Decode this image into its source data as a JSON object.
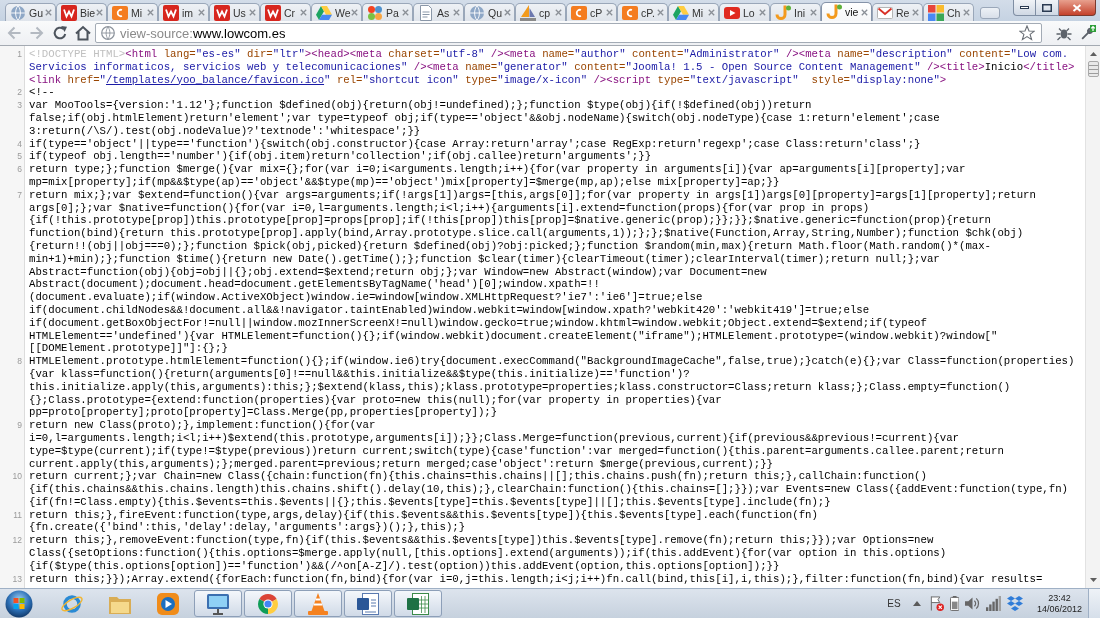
{
  "tabs": [
    {
      "title": "Gu",
      "kind": "globe",
      "selected": false
    },
    {
      "title": "Bie",
      "kind": "zigzag",
      "selected": false
    },
    {
      "title": "Mi",
      "kind": "arc",
      "selected": false
    },
    {
      "title": "im",
      "kind": "zigzag",
      "selected": false
    },
    {
      "title": "Us",
      "kind": "zigzag",
      "selected": false
    },
    {
      "title": "Cr",
      "kind": "zigzag",
      "selected": false
    },
    {
      "title": "We",
      "kind": "triangle",
      "selected": false
    },
    {
      "title": "Pa",
      "kind": "pinwheel",
      "selected": false
    },
    {
      "title": "As",
      "kind": "document",
      "selected": false
    },
    {
      "title": "Qu",
      "kind": "globe",
      "selected": false
    },
    {
      "title": "cp",
      "kind": "sail",
      "selected": false
    },
    {
      "title": "cP",
      "kind": "arc",
      "selected": false
    },
    {
      "title": "cP.",
      "kind": "arc",
      "selected": false
    },
    {
      "title": "Mi",
      "kind": "triangle",
      "selected": false
    },
    {
      "title": "Lo",
      "kind": "play",
      "selected": false
    },
    {
      "title": "Ini",
      "kind": "hook",
      "selected": false
    },
    {
      "title": "vie",
      "kind": "hook",
      "selected": true
    },
    {
      "title": "Re",
      "kind": "envelope",
      "selected": false
    },
    {
      "title": "Ch",
      "kind": "blocks",
      "selected": false
    }
  ],
  "toolbar": {
    "nav": [
      {
        "kind": "back",
        "disabled": true
      },
      {
        "kind": "forward",
        "disabled": true
      },
      {
        "kind": "reload",
        "disabled": false
      },
      {
        "kind": "home",
        "disabled": false
      }
    ],
    "address": {
      "prefix": "view-source:",
      "host": "www.lowcom.es"
    }
  },
  "source": {
    "lines": [
      {
        "number": "1",
        "wrapped": [
          {
            "parts": [
              {
                "kind": "doctype",
                "text": "<!DOCTYPE HTML>"
              },
              {
                "kind": "tag",
                "text": "<html "
              },
              {
                "kind": "attr",
                "text": "lang="
              },
              {
                "kind": "value",
                "text": "\"es-es\""
              },
              {
                "kind": "attr",
                "text": " dir="
              },
              {
                "kind": "value",
                "text": "\"ltr\""
              },
              {
                "kind": "tag",
                "text": "><head><meta "
              },
              {
                "kind": "attr",
                "text": "charset="
              },
              {
                "kind": "value",
                "text": "\"utf-8\""
              },
              {
                "kind": "tag",
                "text": " /><meta "
              },
              {
                "kind": "attr",
                "text": "name="
              },
              {
                "kind": "value",
                "text": "\"author\""
              },
              {
                "kind": "attr",
                "text": " content="
              },
              {
                "kind": "value",
                "text": "\"Administrator\""
              },
              {
                "kind": "tag",
                "text": " /><meta "
              },
              {
                "kind": "attr",
                "text": "name="
              },
              {
                "kind": "value",
                "text": "\"description\""
              },
              {
                "kind": "attr",
                "text": " content="
              },
              {
                "kind": "value",
                "text": "\"Low com."
              }
            ]
          },
          {
            "parts": [
              {
                "kind": "value",
                "text": "Servicios informaticos, servicios web y telecomunicaciones\""
              },
              {
                "kind": "tag",
                "text": " /><meta "
              },
              {
                "kind": "attr",
                "text": "name="
              },
              {
                "kind": "value",
                "text": "\"generator\""
              },
              {
                "kind": "attr",
                "text": " content="
              },
              {
                "kind": "value",
                "text": "\"Joomla! 1.5 - Open Source Content Management\""
              },
              {
                "kind": "tag",
                "text": " /><title>"
              },
              {
                "kind": "text",
                "text": "Inicio"
              },
              {
                "kind": "tag",
                "text": "</title>"
              }
            ]
          },
          {
            "parts": [
              {
                "kind": "tag",
                "text": "<link "
              },
              {
                "kind": "attr",
                "text": "href="
              },
              {
                "kind": "value",
                "text": "\""
              },
              {
                "kind": "link",
                "text": "/templates/yoo_balance/favicon.ico"
              },
              {
                "kind": "value",
                "text": "\""
              },
              {
                "kind": "attr",
                "text": " rel="
              },
              {
                "kind": "value",
                "text": "\"shortcut icon\""
              },
              {
                "kind": "attr",
                "text": " type="
              },
              {
                "kind": "value",
                "text": "\"image/x-icon\""
              },
              {
                "kind": "tag",
                "text": " /><script "
              },
              {
                "kind": "attr",
                "text": "type="
              },
              {
                "kind": "value",
                "text": "\"text/javascript\""
              },
              {
                "kind": "attr",
                "text": "  style="
              },
              {
                "kind": "value",
                "text": "\"display:none\""
              },
              {
                "kind": "tag",
                "text": ">"
              }
            ]
          }
        ]
      },
      {
        "number": "2",
        "wrapped": [
          {
            "parts": [
              {
                "kind": "text",
                "text": "<!--"
              }
            ]
          }
        ]
      },
      {
        "number": "3",
        "wrapped": [
          {
            "parts": [
              {
                "kind": "text",
                "text": "var MooTools={version:'1.12'};function $defined(obj){return(obj!=undefined);};function $type(obj){if(!$defined(obj))return"
              }
            ]
          },
          {
            "parts": [
              {
                "kind": "text",
                "text": "false;if(obj.htmlElement)return'element';var type=typeof obj;if(type=='object'&&obj.nodeName){switch(obj.nodeType){case 1:return'element';case"
              }
            ]
          },
          {
            "parts": [
              {
                "kind": "text",
                "text": "3:return(/\\S/).test(obj.nodeValue)?'textnode':'whitespace';}}"
              }
            ]
          }
        ]
      },
      {
        "number": "4",
        "wrapped": [
          {
            "parts": [
              {
                "kind": "text",
                "text": "if(type=='object'||type=='function'){switch(obj.constructor){case Array:return'array';case RegExp:return'regexp';case Class:return'class';}"
              }
            ]
          }
        ]
      },
      {
        "number": "5",
        "wrapped": [
          {
            "parts": [
              {
                "kind": "text",
                "text": "if(typeof obj.length=='number'){if(obj.item)return'collection';if(obj.callee)return'arguments';}}"
              }
            ]
          }
        ]
      },
      {
        "number": "6",
        "wrapped": [
          {
            "parts": [
              {
                "kind": "text",
                "text": "return type;};function $merge(){var mix={};for(var i=0;i<arguments.length;i++){for(var property in arguments[i]){var ap=arguments[i][property];var"
              }
            ]
          },
          {
            "parts": [
              {
                "kind": "text",
                "text": "mp=mix[property];if(mp&&$type(ap)=='object'&&$type(mp)=='object')mix[property]=$merge(mp,ap);else mix[property]=ap;}}"
              }
            ]
          }
        ]
      },
      {
        "number": "7",
        "wrapped": [
          {
            "parts": [
              {
                "kind": "text",
                "text": "return mix;};var $extend=function(){var args=arguments;if(!args[1])args=[this,args[0]];for(var property in args[1])args[0][property]=args[1][property];return"
              }
            ]
          },
          {
            "parts": [
              {
                "kind": "text",
                "text": "args[0];};var $native=function(){for(var i=0,l=arguments.length;i<l;i++){arguments[i].extend=function(props){for(var prop in props)"
              }
            ]
          },
          {
            "parts": [
              {
                "kind": "text",
                "text": "{if(!this.prototype[prop])this.prototype[prop]=props[prop];if(!this[prop])this[prop]=$native.generic(prop);}};}};$native.generic=function(prop){return"
              }
            ]
          },
          {
            "parts": [
              {
                "kind": "text",
                "text": "function(bind){return this.prototype[prop].apply(bind,Array.prototype.slice.call(arguments,1));};};$native(Function,Array,String,Number);function $chk(obj)"
              }
            ]
          },
          {
            "parts": [
              {
                "kind": "text",
                "text": "{return!!(obj||obj===0);};function $pick(obj,picked){return $defined(obj)?obj:picked;};function $random(min,max){return Math.floor(Math.random()*(max-"
              }
            ]
          },
          {
            "parts": [
              {
                "kind": "text",
                "text": "min+1)+min);};function $time(){return new Date().getTime();};function $clear(timer){clearTimeout(timer);clearInterval(timer);return null;};var"
              }
            ]
          },
          {
            "parts": [
              {
                "kind": "text",
                "text": "Abstract=function(obj){obj=obj||{};obj.extend=$extend;return obj;};var Window=new Abstract(window);var Document=new"
              }
            ]
          },
          {
            "parts": [
              {
                "kind": "text",
                "text": "Abstract(document);document.head=document.getElementsByTagName('head')[0];window.xpath=!!"
              }
            ]
          },
          {
            "parts": [
              {
                "kind": "text",
                "text": "(document.evaluate);if(window.ActiveXObject)window.ie=window[window.XMLHttpRequest?'ie7':'ie6']=true;else"
              }
            ]
          },
          {
            "parts": [
              {
                "kind": "text",
                "text": "if(document.childNodes&&!document.all&&!navigator.taintEnabled)window.webkit=window[window.xpath?'webkit420':'webkit419']=true;else"
              }
            ]
          },
          {
            "parts": [
              {
                "kind": "text",
                "text": "if(document.getBoxObjectFor!=null||window.mozInnerScreenX!=null)window.gecko=true;window.khtml=window.webkit;Object.extend=$extend;if(typeof"
              }
            ]
          },
          {
            "parts": [
              {
                "kind": "text",
                "text": "HTMLElement=='undefined'){var HTMLElement=function(){};if(window.webkit)document.createElement(\"iframe\");HTMLElement.prototype=(window.webkit)?window[\""
              }
            ]
          },
          {
            "parts": [
              {
                "kind": "text",
                "text": "[[DOMElement.prototype]]\"]:{};}"
              }
            ]
          }
        ]
      },
      {
        "number": "8",
        "wrapped": [
          {
            "parts": [
              {
                "kind": "text",
                "text": "HTMLElement.prototype.htmlElement=function(){};if(window.ie6)try{document.execCommand(\"BackgroundImageCache\",false,true);}catch(e){};var Class=function(properties)"
              }
            ]
          },
          {
            "parts": [
              {
                "kind": "text",
                "text": "{var klass=function(){return(arguments[0]!==null&&this.initialize&&$type(this.initialize)=='function')?"
              }
            ]
          },
          {
            "parts": [
              {
                "kind": "text",
                "text": "this.initialize.apply(this,arguments):this;};$extend(klass,this);klass.prototype=properties;klass.constructor=Class;return klass;};Class.empty=function()"
              }
            ]
          },
          {
            "parts": [
              {
                "kind": "text",
                "text": "{};Class.prototype={extend:function(properties){var proto=new this(null);for(var property in properties){var"
              }
            ]
          },
          {
            "parts": [
              {
                "kind": "text",
                "text": "pp=proto[property];proto[property]=Class.Merge(pp,properties[property]);}"
              }
            ]
          }
        ]
      },
      {
        "number": "9",
        "wrapped": [
          {
            "parts": [
              {
                "kind": "text",
                "text": "return new Class(proto);},implement:function(){for(var"
              }
            ]
          },
          {
            "parts": [
              {
                "kind": "text",
                "text": "i=0,l=arguments.length;i<l;i++)$extend(this.prototype,arguments[i]);}};Class.Merge=function(previous,current){if(previous&&previous!=current){var"
              }
            ]
          },
          {
            "parts": [
              {
                "kind": "text",
                "text": "type=$type(current);if(type!=$type(previous))return current;switch(type){case'function':var merged=function(){this.parent=arguments.callee.parent;return"
              }
            ]
          },
          {
            "parts": [
              {
                "kind": "text",
                "text": "current.apply(this,arguments);};merged.parent=previous;return merged;case'object':return $merge(previous,current);}}"
              }
            ]
          }
        ]
      },
      {
        "number": "10",
        "wrapped": [
          {
            "parts": [
              {
                "kind": "text",
                "text": "return current;};var Chain=new Class({chain:function(fn){this.chains=this.chains||[];this.chains.push(fn);return this;},callChain:function()"
              }
            ]
          },
          {
            "parts": [
              {
                "kind": "text",
                "text": "{if(this.chains&&this.chains.length)this.chains.shift().delay(10,this);},clearChain:function(){this.chains=[];}});var Events=new Class({addEvent:function(type,fn)"
              }
            ]
          },
          {
            "parts": [
              {
                "kind": "text",
                "text": "{if(fn!=Class.empty){this.$events=this.$events||{};this.$events[type]=this.$events[type]||[];this.$events[type].include(fn);}"
              }
            ]
          }
        ]
      },
      {
        "number": "11",
        "wrapped": [
          {
            "parts": [
              {
                "kind": "text",
                "text": "return this;},fireEvent:function(type,args,delay){if(this.$events&&this.$events[type]){this.$events[type].each(function(fn)"
              }
            ]
          },
          {
            "parts": [
              {
                "kind": "text",
                "text": "{fn.create({'bind':this,'delay':delay,'arguments':args})();},this);}"
              }
            ]
          }
        ]
      },
      {
        "number": "12",
        "wrapped": [
          {
            "parts": [
              {
                "kind": "text",
                "text": "return this;},removeEvent:function(type,fn){if(this.$events&&this.$events[type])this.$events[type].remove(fn);return this;}});var Options=new"
              }
            ]
          },
          {
            "parts": [
              {
                "kind": "text",
                "text": "Class({setOptions:function(){this.options=$merge.apply(null,[this.options].extend(arguments));if(this.addEvent){for(var option in this.options)"
              }
            ]
          },
          {
            "parts": [
              {
                "kind": "text",
                "text": "{if($type(this.options[option])=='function')&&(/^on[A-Z]/).test(option))this.addEvent(option,this.options[option]);}}"
              }
            ]
          }
        ]
      },
      {
        "number": "13",
        "wrapped": [
          {
            "parts": [
              {
                "kind": "text",
                "text": "return this;}});Array.extend({forEach:function(fn,bind){for(var i=0,j=this.length;i<j;i++)fn.call(bind,this[i],i,this);},filter:function(fn,bind){var results="
              }
            ]
          }
        ]
      }
    ]
  },
  "taskbar": {
    "apps": [
      {
        "kind": "browser",
        "running": false
      },
      {
        "kind": "folder",
        "running": false
      },
      {
        "kind": "player",
        "running": false
      },
      {
        "kind": "monitor",
        "running": true
      },
      {
        "kind": "wheel",
        "running": true
      },
      {
        "kind": "cone",
        "running": true
      },
      {
        "kind": "document",
        "running": true
      },
      {
        "kind": "spreadsheet",
        "running": true
      }
    ],
    "tray": {
      "language": "ES",
      "time": "23:42",
      "date": "14/06/2012"
    }
  }
}
